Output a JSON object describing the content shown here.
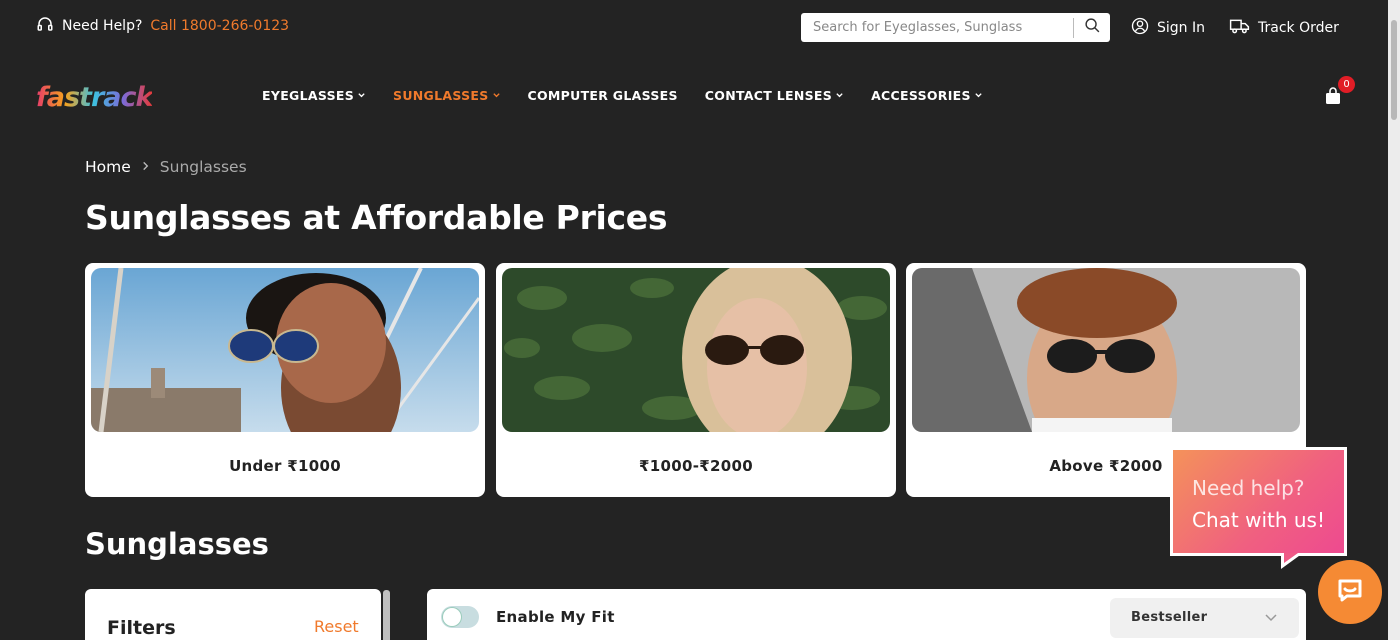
{
  "topbar": {
    "help_text": "Need Help?",
    "phone": "Call 1800-266-0123",
    "search_placeholder": "Search for Eyeglasses, Sunglass",
    "sign_in": "Sign In",
    "track_order": "Track Order"
  },
  "nav": {
    "logo": "fastrack",
    "items": [
      {
        "label": "EYEGLASSES",
        "dropdown": true,
        "active": false
      },
      {
        "label": "SUNGLASSES",
        "dropdown": true,
        "active": true
      },
      {
        "label": "COMPUTER GLASSES",
        "dropdown": false,
        "active": false
      },
      {
        "label": "CONTACT LENSES",
        "dropdown": true,
        "active": false
      },
      {
        "label": "ACCESSORIES",
        "dropdown": true,
        "active": false
      }
    ],
    "cart_count": "0"
  },
  "breadcrumb": {
    "home": "Home",
    "current": "Sunglasses"
  },
  "page_title": "Sunglasses at Affordable Prices",
  "price_cards": [
    {
      "label": "Under ₹1000"
    },
    {
      "label": "₹1000-₹2000"
    },
    {
      "label": "Above ₹2000"
    }
  ],
  "section_title": "Sunglasses",
  "filters": {
    "title": "Filters",
    "reset": "Reset"
  },
  "toolbar": {
    "my_fit": "Enable My Fit",
    "sort_value": "Bestseller"
  },
  "chat": {
    "line1": "Need help?",
    "line2": "Chat with us!"
  },
  "colors": {
    "accent": "#f07a2c",
    "background": "#232323",
    "badge": "#e11d26"
  }
}
